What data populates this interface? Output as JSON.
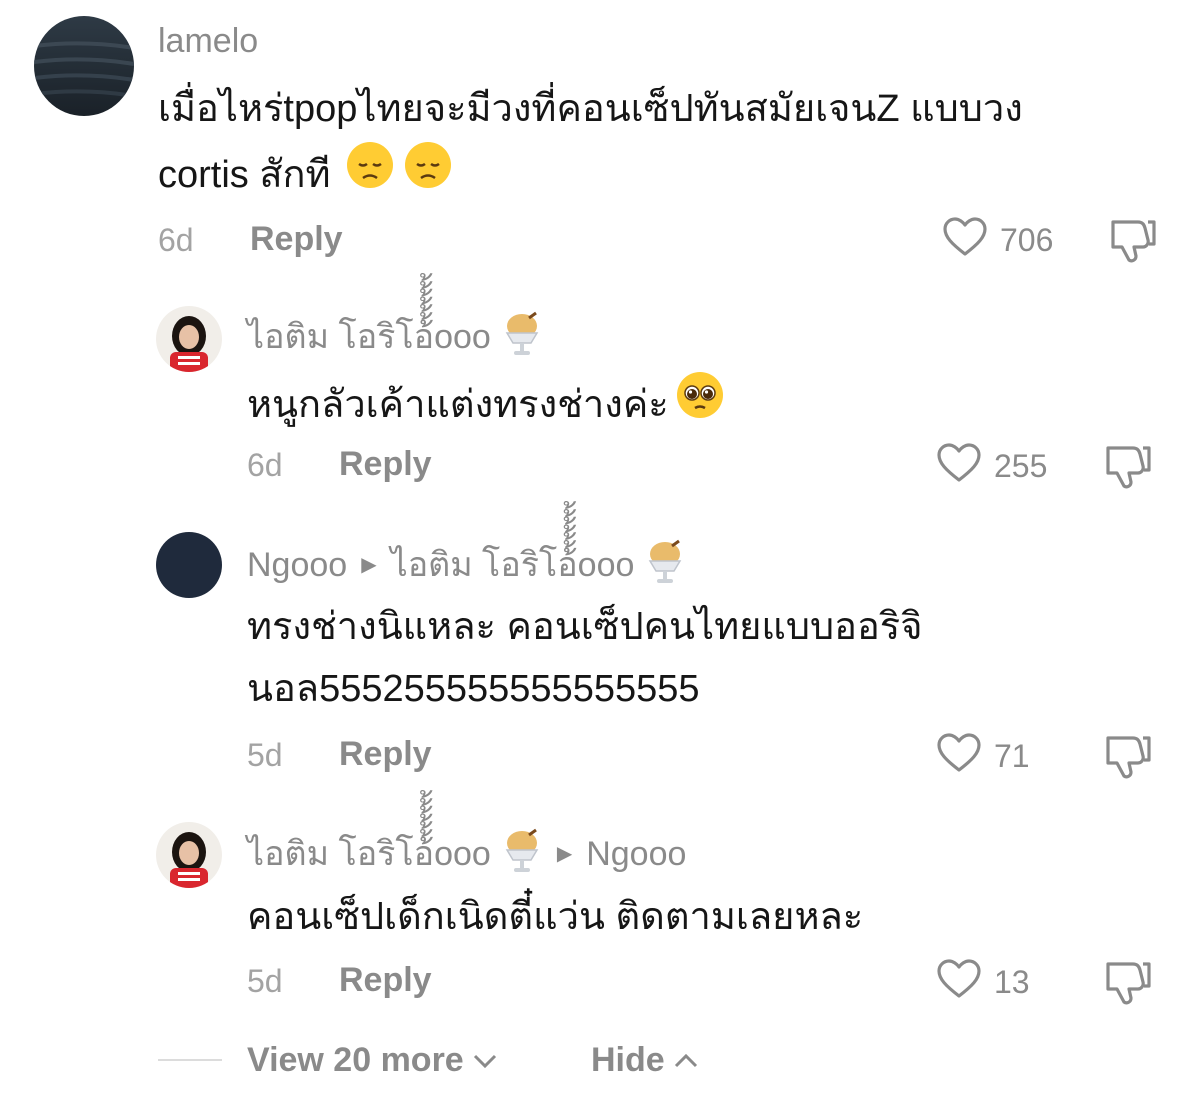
{
  "comments": [
    {
      "username": "lamelo",
      "reply_to": "",
      "text_lines": [
        "เมื่อไหร่tpopไทยจะมีวงที่คอนเซ็ปทันสมัยเจนZ แบบวง",
        "cortis สักที"
      ],
      "emojis": [
        "disappointed-face",
        "disappointed-face"
      ],
      "age": "6d",
      "reply_label": "Reply",
      "likes": "706"
    },
    {
      "username": "ไอติม โอริโอ้้้้้้้ooo",
      "reply_to": "",
      "text_lines": [
        "หนูกลัวเค้าแต่งทรงช่างค่ะ"
      ],
      "emojis": [
        "pleading-face"
      ],
      "age": "6d",
      "reply_label": "Reply",
      "likes": "255"
    },
    {
      "username": "Ngooo",
      "reply_to": "ไอติม โอริโอ้้้้้้้ooo",
      "text_lines": [
        "ทรงช่างนิแหละ คอนเซ็ปคนไทยแบบออริจิ",
        "นอล555255555555555555"
      ],
      "emojis": [],
      "age": "5d",
      "reply_label": "Reply",
      "likes": "71"
    },
    {
      "username": "ไอติม โอริโอ้้้้้้้ooo",
      "reply_to": "Ngooo",
      "text_lines": [
        "คอนเซ็ปเด็กเนิดตี๋แว่น ติดตามเลยหละ"
      ],
      "emojis": [],
      "age": "5d",
      "reply_label": "Reply",
      "likes": "13"
    }
  ],
  "footer": {
    "view_more": "View 20 more",
    "hide": "Hide"
  },
  "icons": {
    "like": "heart-outline-icon",
    "dislike": "thumbs-down-icon",
    "username_emoji": "ice-cream-icon",
    "reply_arrow": "play-arrow-icon"
  },
  "colors": {
    "text": "#161616",
    "secondary": "#8a8a8a",
    "meta": "#a3a3a3"
  }
}
